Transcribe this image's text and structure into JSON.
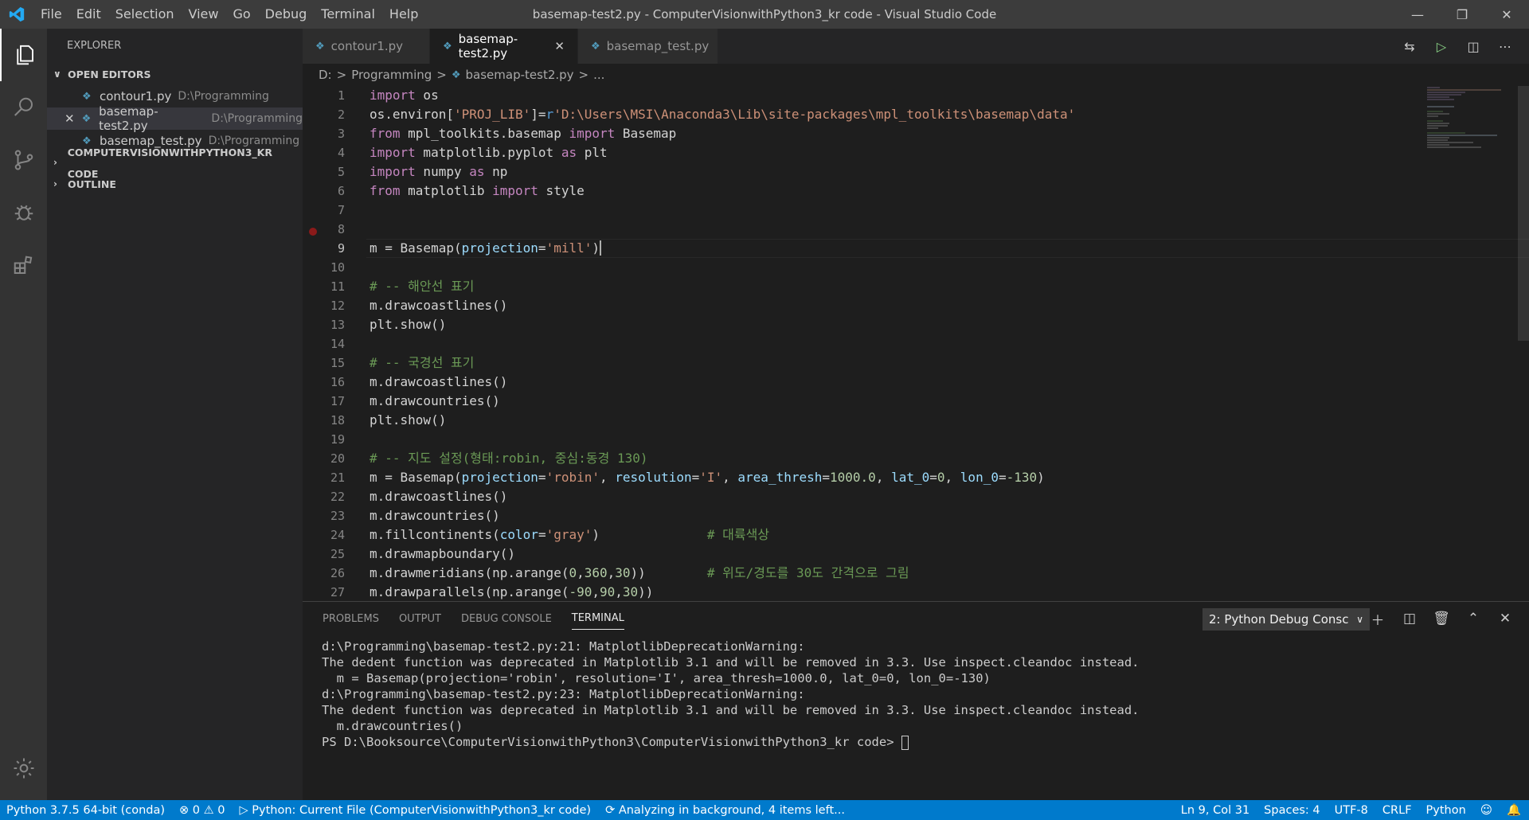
{
  "window": {
    "title": "basemap-test2.py - ComputerVisionwithPython3_kr code - Visual Studio Code",
    "menu": [
      "File",
      "Edit",
      "Selection",
      "View",
      "Go",
      "Debug",
      "Terminal",
      "Help"
    ]
  },
  "sidebar": {
    "title": "EXPLORER",
    "open_editors_label": "OPEN EDITORS",
    "open_editors": [
      {
        "name": "contour1.py",
        "path": "D:\\Programming"
      },
      {
        "name": "basemap-test2.py",
        "path": "D:\\Programming"
      },
      {
        "name": "basemap_test.py",
        "path": "D:\\Programming"
      }
    ],
    "project_label": "COMPUTERVISIONWITHPYTHON3_KR CODE",
    "outline_label": "OUTLINE"
  },
  "tabs": [
    {
      "label": "contour1.py"
    },
    {
      "label": "basemap-test2.py"
    },
    {
      "label": "basemap_test.py"
    }
  ],
  "breadcrumb": {
    "drive": "D:",
    "sep": ">",
    "folder": "Programming",
    "file": "basemap-test2.py",
    "more": "..."
  },
  "editor": {
    "line_numbers": [
      "1",
      "2",
      "3",
      "4",
      "5",
      "6",
      "7",
      "8",
      "9",
      "10",
      "11",
      "12",
      "13",
      "14",
      "15",
      "16",
      "17",
      "18",
      "19",
      "20",
      "21",
      "22",
      "23",
      "24",
      "25",
      "26",
      "27"
    ]
  },
  "panel": {
    "tabs": [
      "PROBLEMS",
      "OUTPUT",
      "DEBUG CONSOLE",
      "TERMINAL"
    ],
    "terminal_select": "2: Python Debug Consc",
    "terminal_lines": [
      "d:\\Programming\\basemap-test2.py:21: MatplotlibDeprecationWarning:",
      "The dedent function was deprecated in Matplotlib 3.1 and will be removed in 3.3. Use inspect.cleandoc instead.",
      "  m = Basemap(projection='robin', resolution='I', area_thresh=1000.0, lat_0=0, lon_0=-130)",
      "d:\\Programming\\basemap-test2.py:23: MatplotlibDeprecationWarning:",
      "The dedent function was deprecated in Matplotlib 3.1 and will be removed in 3.3. Use inspect.cleandoc instead.",
      "  m.drawcountries()"
    ],
    "prompt": "PS D:\\Booksource\\ComputerVisionwithPython3\\ComputerVisionwithPython3_kr code> "
  },
  "statusbar": {
    "interpreter": "Python 3.7.5 64-bit (conda)",
    "errors": "0",
    "warnings": "0",
    "run_config": "Python: Current File (ComputerVisionwithPython3_kr code)",
    "analysis": "Analyzing in background, 4 items left...",
    "position": "Ln 9, Col 31",
    "spaces": "Spaces: 4",
    "encoding": "UTF-8",
    "eol": "CRLF",
    "language": "Python"
  },
  "colors": {
    "accent": "#007acc",
    "titlebar": "#3c3c3c",
    "sidebar": "#252526",
    "editor": "#1e1e1e"
  }
}
